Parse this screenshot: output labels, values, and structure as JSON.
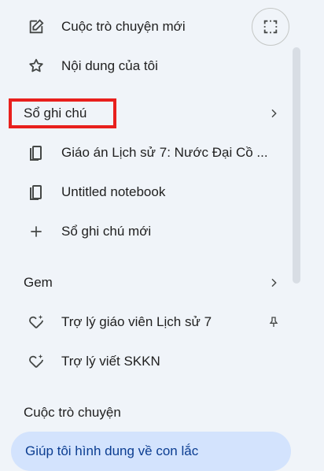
{
  "top": {
    "new_chat_label": "Cuộc trò chuyện mới",
    "my_content_label": "Nội dung của tôi"
  },
  "notebooks": {
    "section_label": "Sổ ghi chú",
    "items": [
      {
        "label": "Giáo án Lịch sử 7: Nước Đại Cồ ..."
      },
      {
        "label": "Untitled notebook"
      }
    ],
    "new_label": "Sổ ghi chú mới"
  },
  "gems": {
    "section_label": "Gem",
    "items": [
      {
        "label": "Trợ lý giáo viên Lịch sử 7",
        "pinned": true
      },
      {
        "label": "Trợ lý viết SKKN",
        "pinned": false
      }
    ]
  },
  "conversations": {
    "section_label": "Cuộc trò chuyện",
    "items": [
      {
        "label": "Giúp tôi hình dung về con lắc",
        "active": true
      }
    ]
  },
  "colors": {
    "background": "#f0f4f9",
    "highlight_box": "#e8201d",
    "active_item": "#d3e3fd"
  }
}
